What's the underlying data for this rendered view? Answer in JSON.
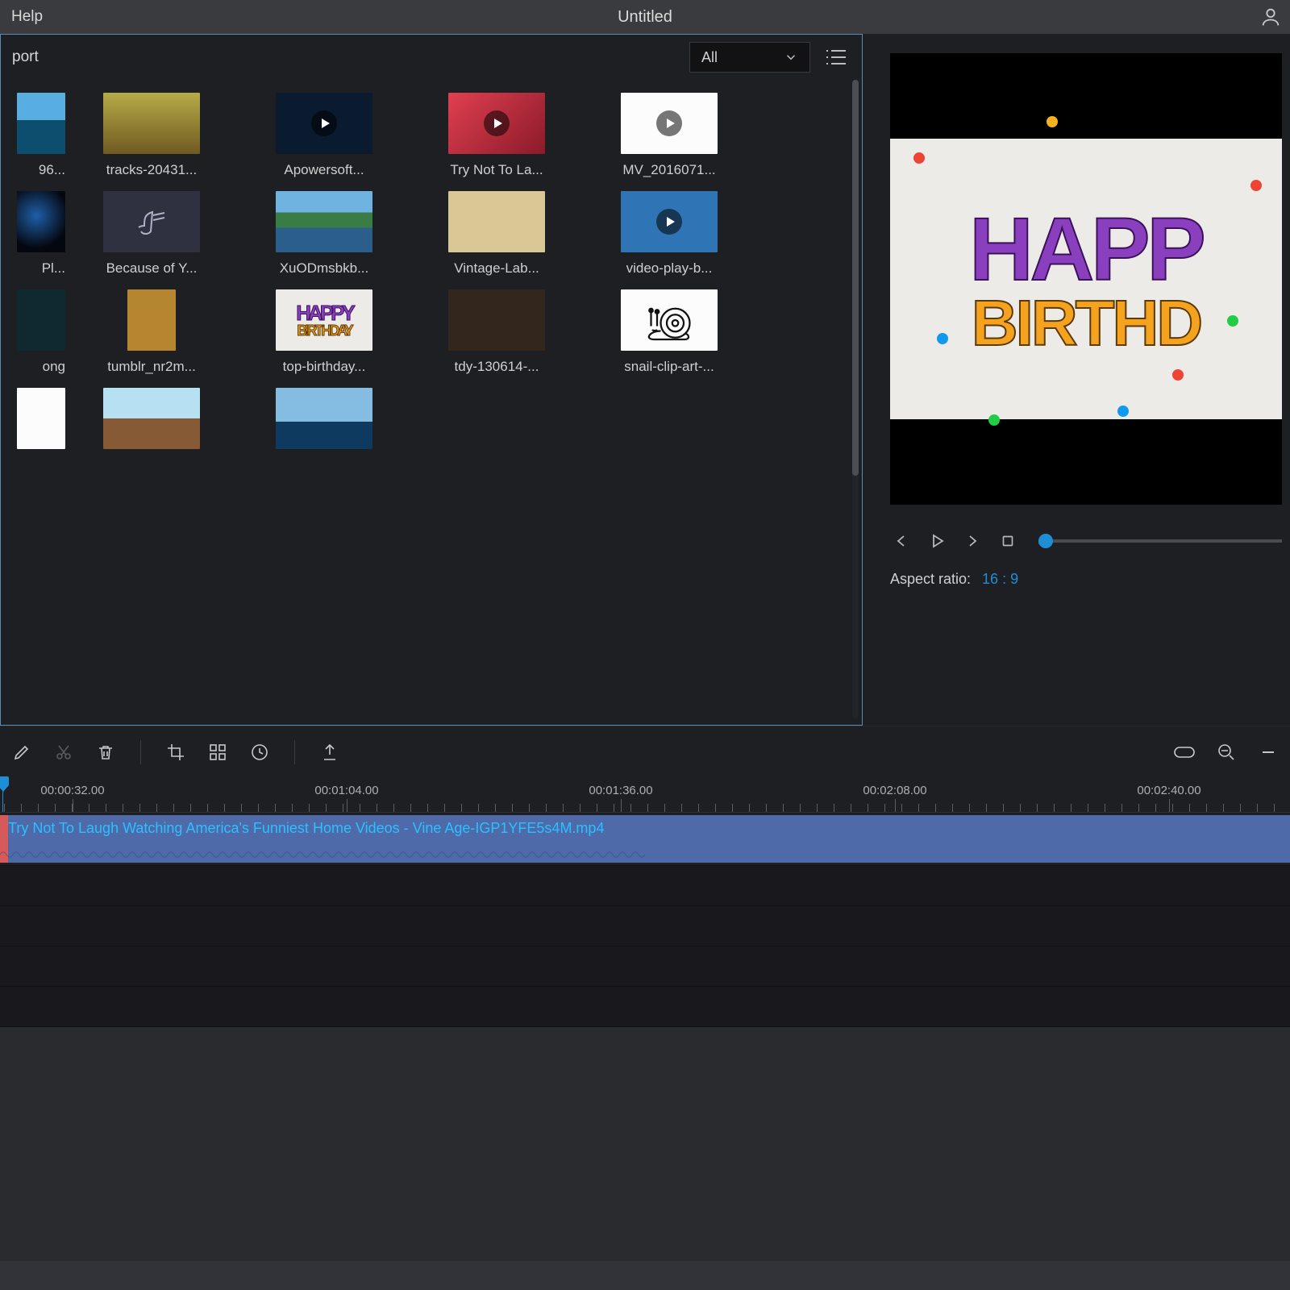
{
  "titlebar": {
    "help": "Help",
    "title": "Untitled"
  },
  "library": {
    "import": "port",
    "filter_label": "All",
    "items": [
      {
        "label": "96...",
        "thumb": "t-ocean",
        "partial": true
      },
      {
        "label": "tracks-20431...",
        "thumb": "t-tracks"
      },
      {
        "label": "Apowersoft...",
        "thumb": "t-dark",
        "play": true
      },
      {
        "label": "Try Not To La...",
        "thumb": "t-red",
        "play": true
      },
      {
        "label": "MV_2016071...",
        "thumb": "t-white",
        "play": true
      },
      {
        "label": "Pl...",
        "thumb": "t-earth",
        "partial": true
      },
      {
        "label": "Because of Y...",
        "thumb": "t-audio",
        "audio": true
      },
      {
        "label": "XuODmsbkb...",
        "thumb": "t-lake"
      },
      {
        "label": "Vintage-Lab...",
        "thumb": "t-vintage"
      },
      {
        "label": "video-play-b...",
        "thumb": "t-blue",
        "play": true
      },
      {
        "label": "ong",
        "thumb": "t-gray",
        "partial": true,
        "portrait": true
      },
      {
        "label": "tumblr_nr2m...",
        "thumb": "t-dog",
        "portrait": true
      },
      {
        "label": "top-birthday...",
        "thumb": "t-hb",
        "hb": true
      },
      {
        "label": "tdy-130614-...",
        "thumb": "t-candle"
      },
      {
        "label": "snail-clip-art-...",
        "thumb": "t-white",
        "snail": true
      },
      {
        "label": "",
        "thumb": "t-white",
        "partial": true
      },
      {
        "label": "",
        "thumb": "t-tree"
      },
      {
        "label": "",
        "thumb": "t-horizon"
      }
    ]
  },
  "preview": {
    "aspect_label": "Aspect ratio:",
    "aspect_value": "16 : 9",
    "art": {
      "line1": "HAPP",
      "line2": "BIRTHD"
    }
  },
  "timeline": {
    "labels": [
      "00:00:32.00",
      "00:01:04.00",
      "00:01:36.00",
      "00:02:08.00",
      "00:02:40.00"
    ],
    "clip_name": "Try Not To Laugh Watching America's Funniest Home Videos - Vine Age-IGP1YFE5s4M.mp4"
  }
}
